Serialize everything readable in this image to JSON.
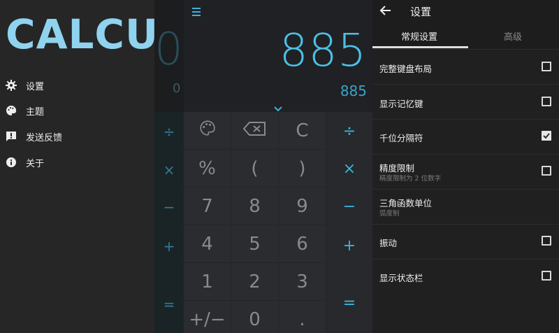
{
  "nav": {
    "logo": "CALCU",
    "items": [
      {
        "label": "设置",
        "icon": "gear-icon"
      },
      {
        "label": "主题",
        "icon": "palette-icon"
      },
      {
        "label": "发送反馈",
        "icon": "feedback-icon"
      },
      {
        "label": "关于",
        "icon": "info-icon"
      }
    ]
  },
  "calculator": {
    "background_display": "0",
    "background_result": "0",
    "display": "885",
    "result": "885",
    "left_ops": [
      "÷",
      "×",
      "−",
      "+",
      "="
    ],
    "keys": [
      [
        "palette-icon",
        "backspace-icon",
        "C"
      ],
      [
        "%",
        "(",
        ")"
      ],
      [
        "7",
        "8",
        "9"
      ],
      [
        "4",
        "5",
        "6"
      ],
      [
        "1",
        "2",
        "3"
      ],
      [
        "+/−",
        "0",
        "."
      ]
    ],
    "right_ops": [
      "÷",
      "×",
      "−",
      "+",
      "="
    ]
  },
  "settings": {
    "title": "设置",
    "tabs": [
      "常规设置",
      "高级"
    ],
    "options": [
      {
        "title": "完整键盘布局",
        "subtitle": "",
        "checked": false
      },
      {
        "title": "显示记忆键",
        "subtitle": "",
        "checked": false
      },
      {
        "title": "千位分隔符",
        "subtitle": "",
        "checked": true
      },
      {
        "title": "精度限制",
        "subtitle": "精度限制为 2 位数字",
        "checked": false
      },
      {
        "title": "三角函数单位",
        "subtitle": "弧度制",
        "checked": null
      },
      {
        "title": "振动",
        "subtitle": "",
        "checked": false
      },
      {
        "title": "显示状态栏",
        "subtitle": "",
        "checked": false
      }
    ]
  },
  "colors": {
    "accent": "#3cb3de",
    "logo": "#8fd3ef",
    "panel": "#262626"
  }
}
